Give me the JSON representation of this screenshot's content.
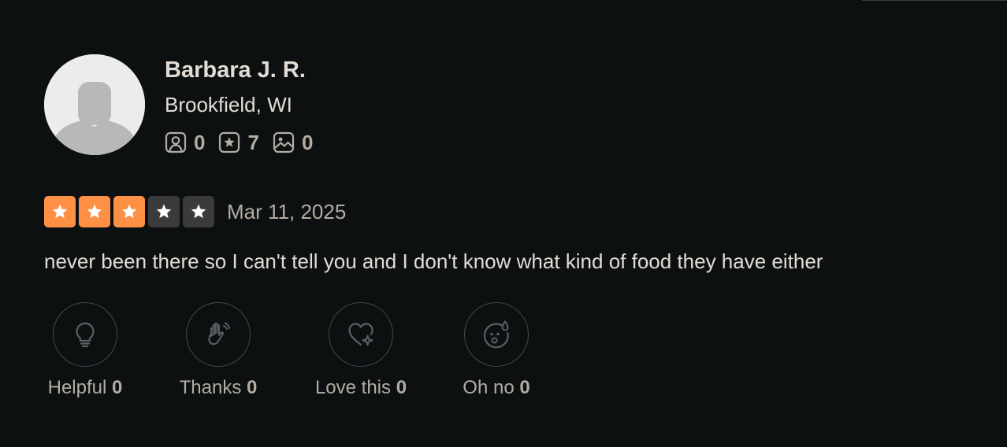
{
  "user": {
    "name": "Barbara J. R.",
    "location": "Brookfield, WI",
    "stats": [
      {
        "icon": "friends-icon",
        "count": "0"
      },
      {
        "icon": "reviews-star-icon",
        "count": "7"
      },
      {
        "icon": "photos-icon",
        "count": "0"
      }
    ]
  },
  "review": {
    "rating": 3,
    "rating_max": 5,
    "date": "Mar 11, 2025",
    "text": "never been there so I can't tell you and I don't know what kind of food they have either"
  },
  "reactions": [
    {
      "label": "Helpful",
      "count": "0",
      "icon": "lightbulb-icon"
    },
    {
      "label": "Thanks",
      "count": "0",
      "icon": "waving-hand-icon"
    },
    {
      "label": "Love this",
      "count": "0",
      "icon": "heart-sparkle-icon"
    },
    {
      "label": "Oh no",
      "count": "0",
      "icon": "sweat-face-icon"
    }
  ],
  "colors": {
    "background": "#0d1011",
    "star_filled": "#fe9045",
    "star_empty": "#3b3b3e",
    "text_primary": "#e2dcd4",
    "text_secondary": "#b3aca3"
  }
}
